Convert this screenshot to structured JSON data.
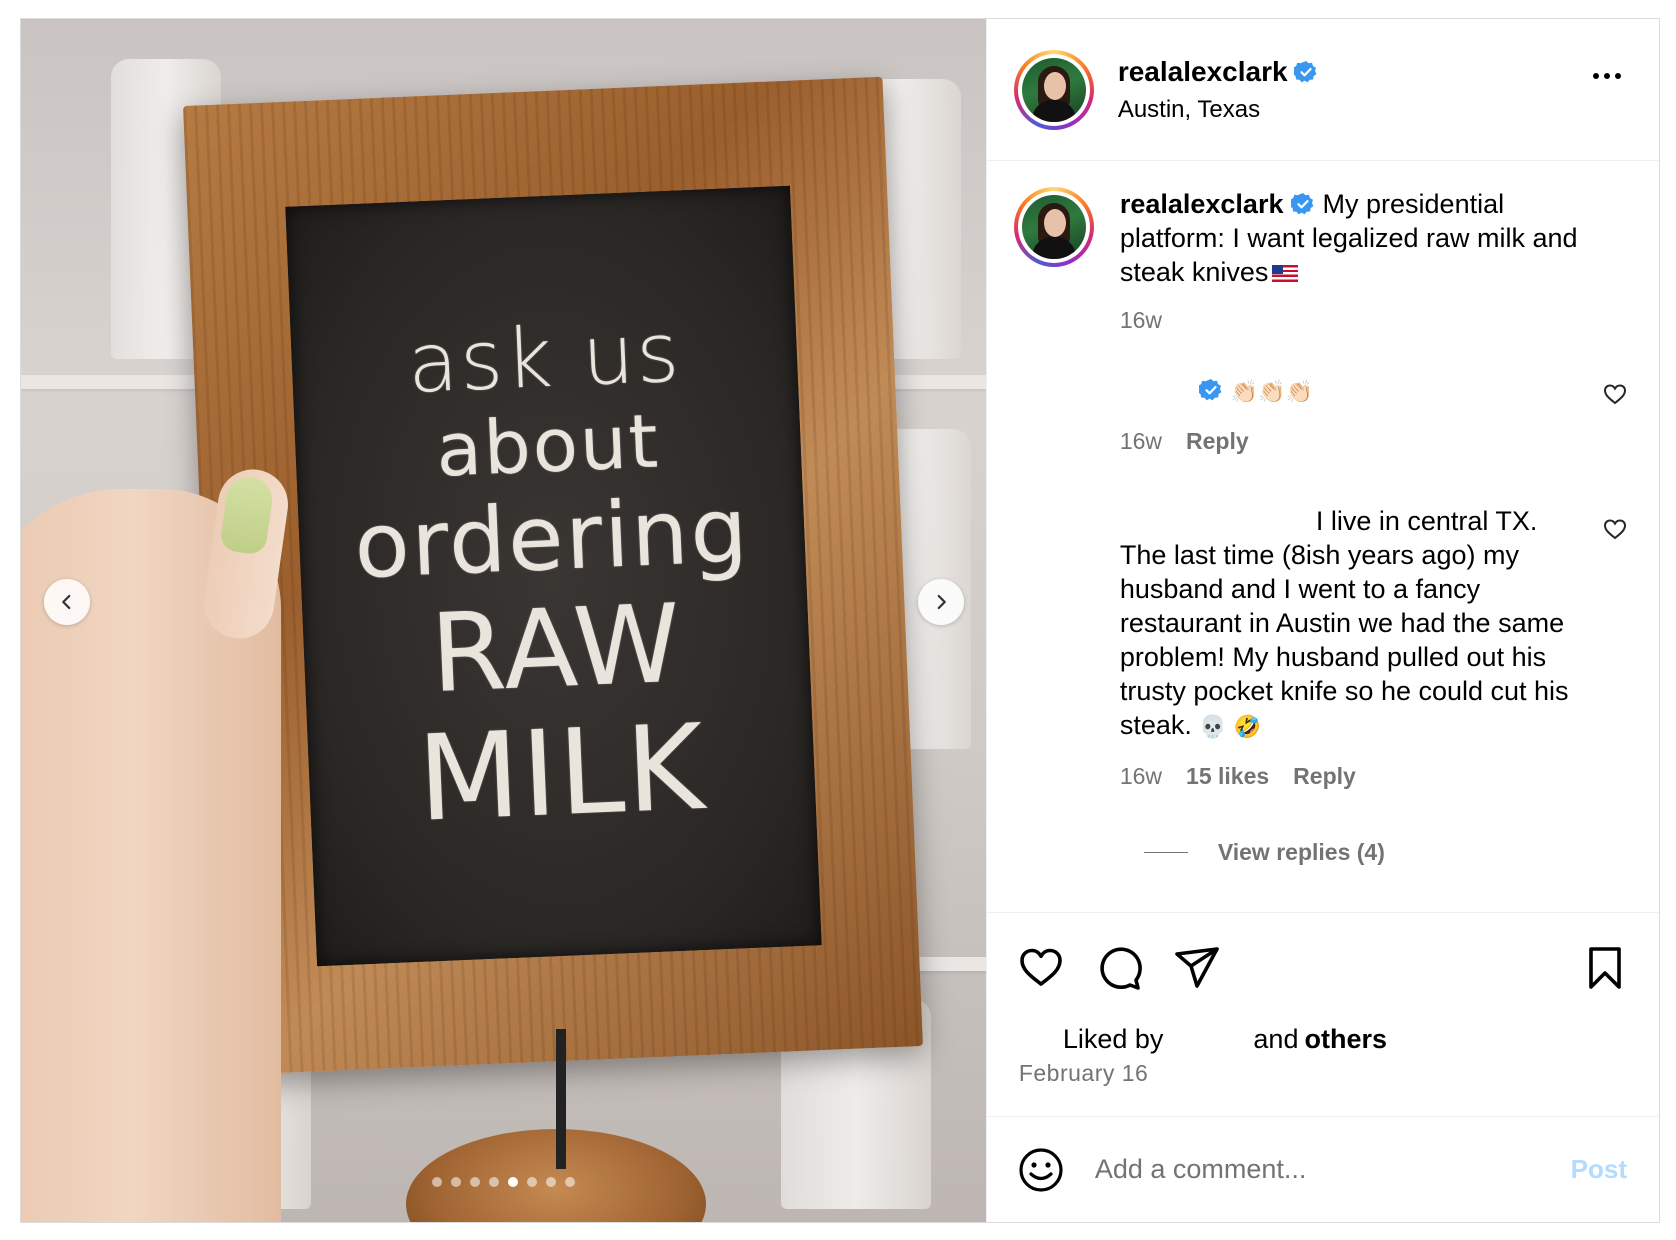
{
  "post": {
    "username": "realalexclark",
    "location": "Austin, Texas",
    "verified": true,
    "avatar_ring_colors": [
      "#feda75",
      "#fa7e1e",
      "#d62976",
      "#962fbf",
      "#4f5bd5"
    ]
  },
  "media": {
    "chalkboard_text": [
      "ask us",
      "about",
      "ordering",
      "RAW",
      "MILK"
    ],
    "carousel": {
      "total": 8,
      "active_index": 4
    },
    "nail_color": "#c8d694"
  },
  "caption": {
    "username": "realalexclark",
    "text": "My presidential platform: I want legalized raw milk and steak knives",
    "flag_emoji": "us-flag",
    "time": "16w"
  },
  "comments": [
    {
      "text": "👏🏻👏🏻👏🏻",
      "time": "16w",
      "reply_label": "Reply"
    },
    {
      "text": "I live in central TX. The last time (8ish years ago) my husband and I went to a fancy restaurant in Austin we had the same problem! My husband pulled out his trusty pocket knife so he could cut his steak.",
      "emojis": "💀 🤣",
      "time": "16w",
      "likes": "15 likes",
      "reply_label": "Reply"
    }
  ],
  "view_replies": "View replies (4)",
  "likes": {
    "liked_by": "Liked by",
    "and_text": "and",
    "others": "others"
  },
  "date": "February 16",
  "comment_box": {
    "placeholder": "Add a comment...",
    "post_label": "Post",
    "post_color": "#b3dbff"
  },
  "colors": {
    "verified_blue": "#3897f0",
    "secondary_text": "#737373",
    "border": "#dbdbdb"
  }
}
